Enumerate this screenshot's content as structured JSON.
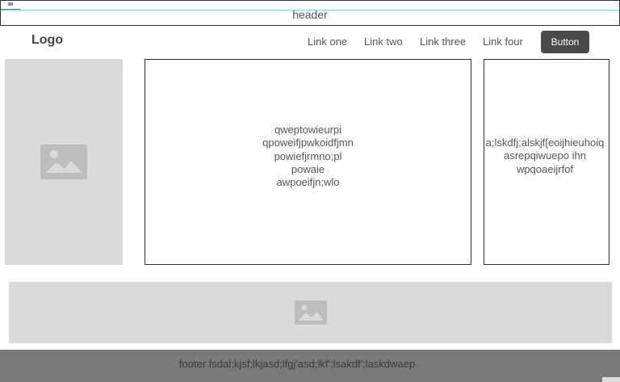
{
  "header": {
    "label": "header"
  },
  "nav": {
    "logo": "Logo",
    "links": [
      "Link one",
      "Link two",
      "Link three",
      "Link four"
    ],
    "button_label": "Button"
  },
  "main": {
    "left_image_icon": "image-icon",
    "center_text": "qweptowieurpi\nqpoweifjpwkoidfjmn\npowiefjrmno;pl\npowaie\nawpoeifjn;wlo",
    "right_text": "a;lskdfj;alskjf[eoijhieuhoiq\nasrepqiwuepo ihn\nwpqoaeijrfof"
  },
  "banner": {
    "image_icon": "image-icon"
  },
  "footer": {
    "text": "footer fsdal;kjsf;lkjasd;lfgj'asd;lkf';lsakdf';laskdwaep"
  },
  "colors": {
    "placeholder_bg": "#dadada",
    "icon_fill": "#bdbdbd",
    "footer_bg": "#7a7a7a",
    "button_bg": "#4a4a4a",
    "border": "#333333"
  }
}
